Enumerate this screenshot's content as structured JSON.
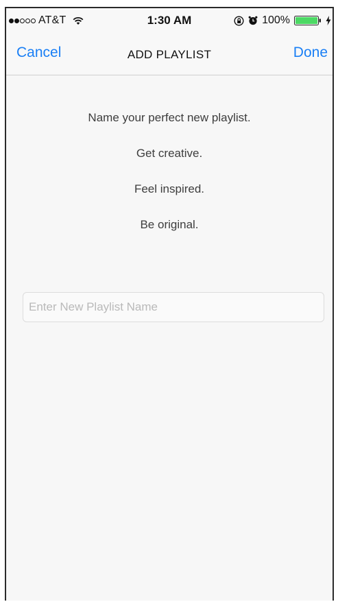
{
  "status_bar": {
    "carrier": "AT&T",
    "signal_strength": 2,
    "signal_max": 5,
    "time": "1:30 AM",
    "battery": "100%",
    "battery_color": "#4cd964",
    "icons": [
      "wifi-icon",
      "rotation-lock-icon",
      "alarm-icon",
      "battery-icon",
      "charging-bolt-icon"
    ]
  },
  "nav": {
    "cancel_label": "Cancel",
    "title": "ADD PLAYLIST",
    "done_label": "Done",
    "accent_color": "#1a7ff5"
  },
  "content": {
    "prompt_lines": [
      "Name your perfect new playlist.",
      "Get creative.",
      "Feel inspired.",
      "Be original."
    ],
    "input": {
      "value": "",
      "placeholder": "Enter New Playlist Name"
    }
  }
}
